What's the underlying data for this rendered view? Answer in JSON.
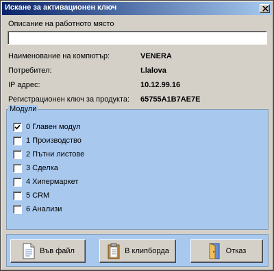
{
  "window": {
    "title": "Искане за активационен ключ"
  },
  "description": {
    "label": "Описание на работното място",
    "value": ""
  },
  "info": {
    "computer_label": "Наименование на компютър:",
    "computer_value": "VENERA",
    "user_label": "Потребител:",
    "user_value": "t.lalova",
    "ip_label": "IP адрес:",
    "ip_value": "10.12.99.16",
    "key_label": "Регистрационен ключ за продукта:",
    "key_value": "65755A1B7AE7E"
  },
  "modules": {
    "legend": "Модули",
    "items": [
      {
        "label": "0  Главен модул",
        "checked": true
      },
      {
        "label": "1  Производство",
        "checked": false
      },
      {
        "label": "2  Пътни листове",
        "checked": false
      },
      {
        "label": "3  Сделка",
        "checked": false
      },
      {
        "label": "4  Хипермаркет",
        "checked": false
      },
      {
        "label": "5  CRM",
        "checked": false
      },
      {
        "label": "6  Анализи",
        "checked": false
      }
    ]
  },
  "buttons": {
    "to_file": "Във файл",
    "to_clipboard": "В клипборда",
    "cancel": "Отказ"
  },
  "colors": {
    "title_start": "#0a246a",
    "title_end": "#a6caf0",
    "panel": "#a8c8ee",
    "face": "#d4d0c8"
  }
}
